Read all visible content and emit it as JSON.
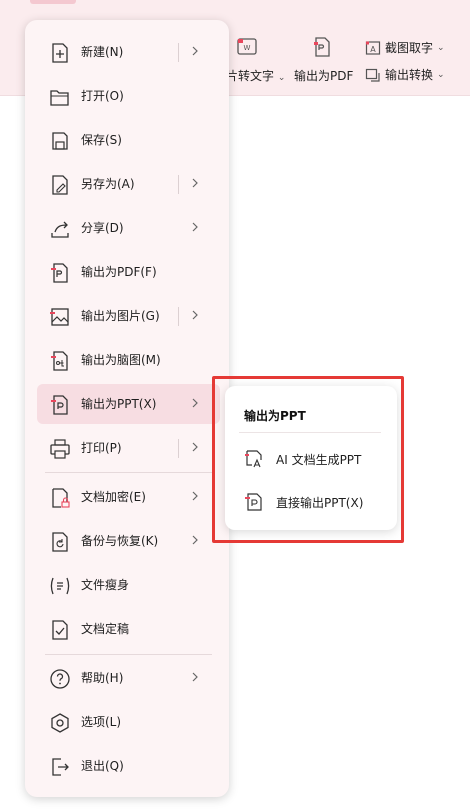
{
  "toolbar": {
    "img_to_text": "片转文字",
    "export_pdf": "输出为PDF",
    "screenshot_ocr": "截图取字",
    "export_convert": "输出转换"
  },
  "menu": {
    "items": [
      {
        "label": "新建(N)"
      },
      {
        "label": "打开(O)"
      },
      {
        "label": "保存(S)"
      },
      {
        "label": "另存为(A)"
      },
      {
        "label": "分享(D)"
      },
      {
        "label": "输出为PDF(F)"
      },
      {
        "label": "输出为图片(G)"
      },
      {
        "label": "输出为脑图(M)"
      },
      {
        "label": "输出为PPT(X)"
      },
      {
        "label": "打印(P)"
      },
      {
        "label": "文档加密(E)"
      },
      {
        "label": "备份与恢复(K)"
      },
      {
        "label": "文件瘦身"
      },
      {
        "label": "文档定稿"
      },
      {
        "label": "帮助(H)"
      },
      {
        "label": "选项(L)"
      },
      {
        "label": "退出(Q)"
      }
    ]
  },
  "submenu": {
    "title": "输出为PPT",
    "items": [
      {
        "label": "AI 文档生成PPT"
      },
      {
        "label": "直接输出PPT(X)"
      }
    ]
  },
  "colors": {
    "menu_bg": "#fdf4f5",
    "active_bg": "#f7dde2",
    "accent": "#e8465c",
    "highlight": "#e53935"
  }
}
